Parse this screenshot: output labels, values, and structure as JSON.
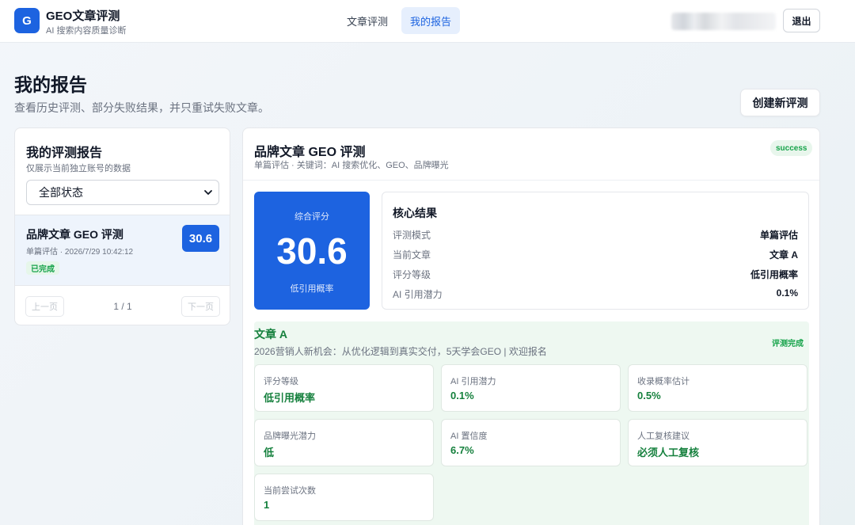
{
  "brand": {
    "logo_letter": "G",
    "title": "GEO文章评测",
    "subtitle": "AI 搜索内容质量诊断"
  },
  "nav": {
    "tabs": [
      {
        "label": "文章评测",
        "active": false
      },
      {
        "label": "我的报告",
        "active": true
      }
    ],
    "logout_label": "退出"
  },
  "page": {
    "title": "我的报告",
    "subtitle": "查看历史评测、部分失败结果，并只重试失败文章。",
    "create_button": "创建新评测"
  },
  "reports_panel": {
    "title": "我的评测报告",
    "subtitle": "仅展示当前独立账号的数据",
    "status_filter": "全部状态",
    "items": [
      {
        "title": "品牌文章 GEO 评测",
        "meta": "单篇评估 · 2026/7/29 10:42:12",
        "status": "已完成",
        "score": "30.6"
      }
    ],
    "pagination": {
      "prev": "上一页",
      "info": "1 / 1",
      "next": "下一页"
    }
  },
  "detail": {
    "title": "品牌文章 GEO 评测",
    "subtitle": "单篇评估 · 关键词：AI 搜索优化、GEO、品牌曝光",
    "status": "success",
    "score_card": {
      "label": "综合评分",
      "value": "30.6",
      "grade": "低引用概率"
    },
    "core": {
      "title": "核心结果",
      "rows": [
        {
          "label": "评测模式",
          "value": "单篇评估"
        },
        {
          "label": "当前文章",
          "value": "文章 A"
        },
        {
          "label": "评分等级",
          "value": "低引用概率"
        },
        {
          "label": "AI 引用潜力",
          "value": "0.1%"
        }
      ]
    },
    "article": {
      "title": "文章 A",
      "subtitle": "2026营销人新机会：从优化逻辑到真实交付，5天学会GEO | 欢迎报名",
      "status": "评测完成",
      "metrics": [
        {
          "label": "评分等级",
          "value": "低引用概率"
        },
        {
          "label": "AI 引用潜力",
          "value": "0.1%"
        },
        {
          "label": "收录概率估计",
          "value": "0.5%"
        },
        {
          "label": "品牌曝光潜力",
          "value": "低"
        },
        {
          "label": "AI 置信度",
          "value": "6.7%"
        },
        {
          "label": "人工复核建议",
          "value": "必须人工复核"
        },
        {
          "label": "当前尝试次数",
          "value": "1"
        }
      ]
    }
  },
  "colors": {
    "accent": "#1d63e0",
    "success": "#16a34a",
    "success_bg": "#eef8f1"
  }
}
